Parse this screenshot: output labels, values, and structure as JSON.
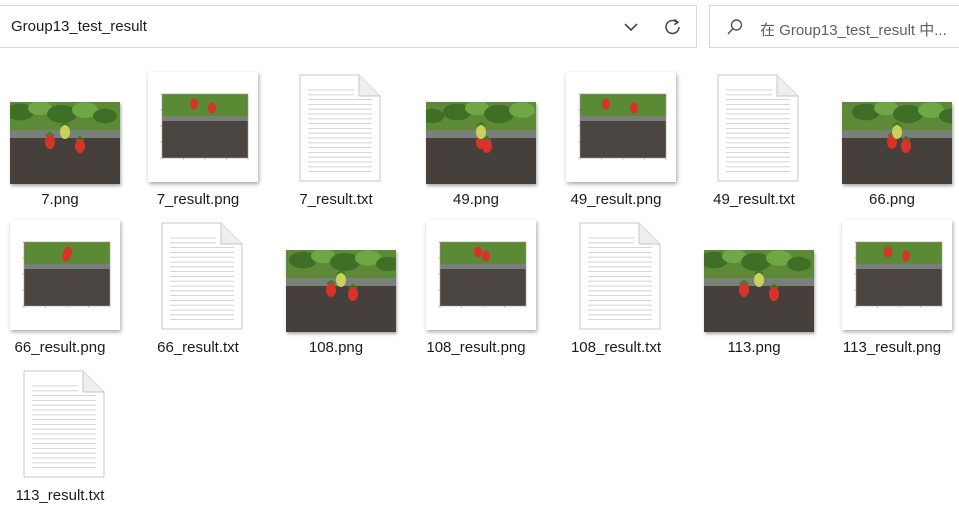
{
  "address_bar": {
    "path": "Group13_test_result"
  },
  "search": {
    "placeholder": "在 Group13_test_result 中..."
  },
  "files": [
    {
      "name": "7.png",
      "type": "image"
    },
    {
      "name": "7_result.png",
      "type": "result"
    },
    {
      "name": "7_result.txt",
      "type": "text"
    },
    {
      "name": "49.png",
      "type": "image"
    },
    {
      "name": "49_result.png",
      "type": "result"
    },
    {
      "name": "49_result.txt",
      "type": "text"
    },
    {
      "name": "66.png",
      "type": "image"
    },
    {
      "name": "66_result.png",
      "type": "result"
    },
    {
      "name": "66_result.txt",
      "type": "text"
    },
    {
      "name": "108.png",
      "type": "image"
    },
    {
      "name": "108_result.png",
      "type": "result"
    },
    {
      "name": "108_result.txt",
      "type": "text"
    },
    {
      "name": "113.png",
      "type": "image"
    },
    {
      "name": "113_result.png",
      "type": "result"
    },
    {
      "name": "113_result.txt",
      "type": "text"
    }
  ],
  "icons": {
    "dropdown": "chevron-down-icon",
    "refresh": "refresh-icon",
    "search": "search-icon",
    "text_file": "text-file-icon",
    "image_file": "image-thumbnail"
  }
}
